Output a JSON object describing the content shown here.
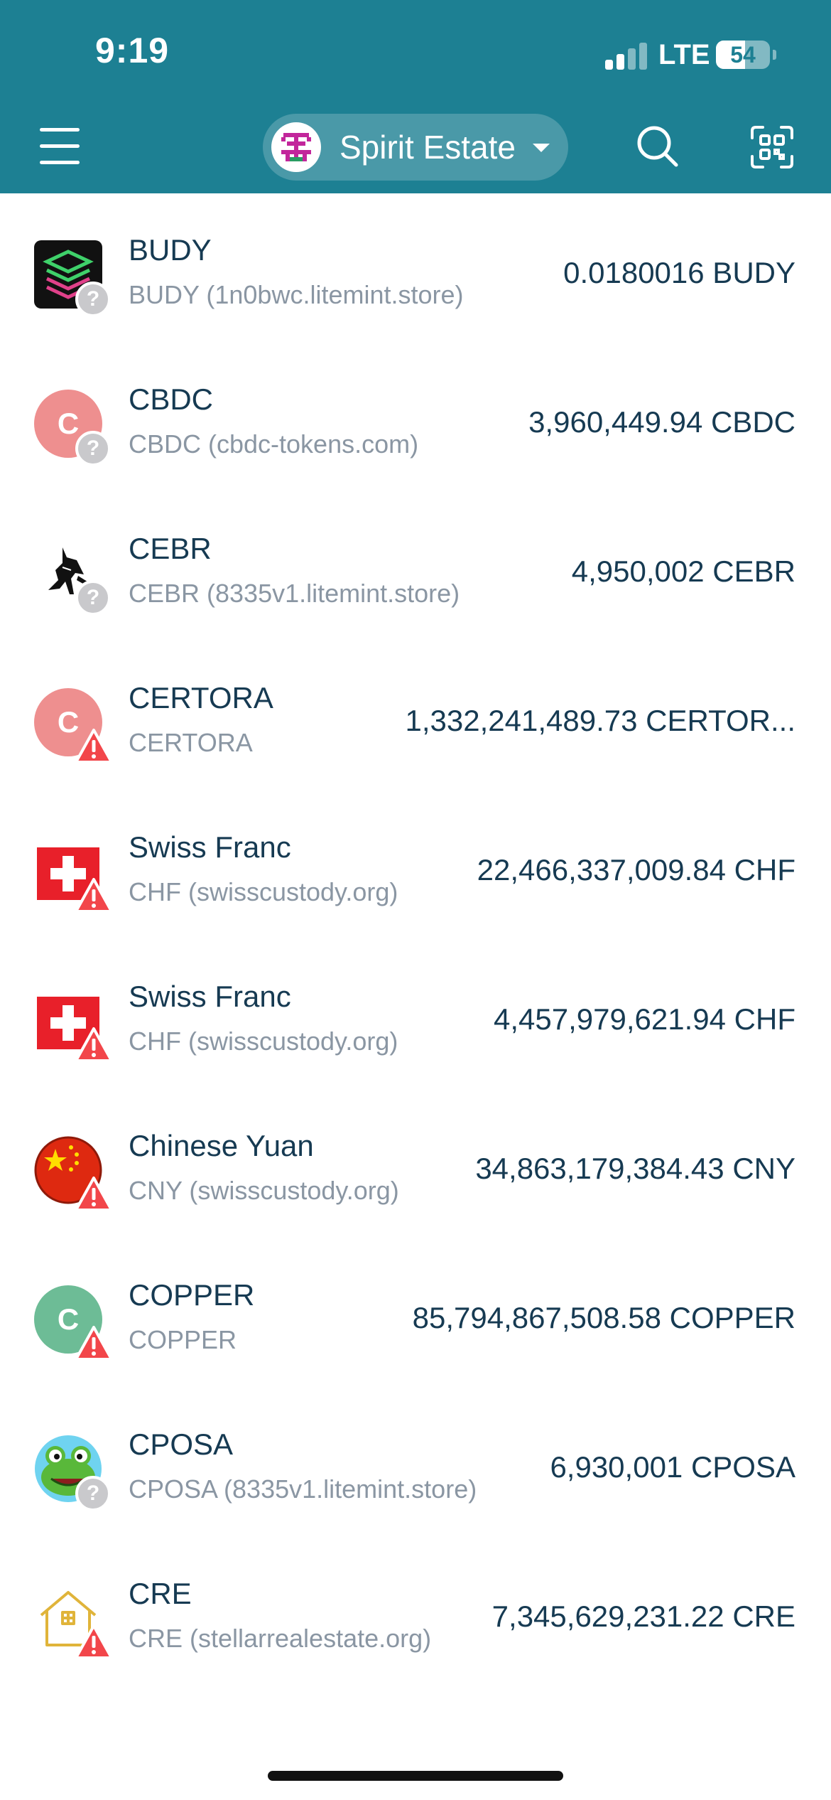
{
  "status_bar": {
    "time": "9:19",
    "network": "LTE",
    "battery": "54",
    "battery_level_percent": 54
  },
  "header": {
    "account_name": "Spirit Estate",
    "menu_icon": "hamburger-menu-icon",
    "search_icon": "search-icon",
    "scan_icon": "qr-scan-icon",
    "background_color": "#1d8093"
  },
  "assets": [
    {
      "name": "BUDY",
      "subtitle": "BUDY (1n0bwc.litemint.store)",
      "amount": "0.0180016 BUDY",
      "icon": "budy-logo-icon",
      "badge": "question"
    },
    {
      "name": "CBDC",
      "subtitle": "CBDC (cbdc-tokens.com)",
      "amount": "3,960,449.94 CBDC",
      "icon": "letter-avatar",
      "letter": "C",
      "avatar_color": "#ee8f8f",
      "badge": "question"
    },
    {
      "name": "CEBR",
      "subtitle": "CEBR (8335v1.litemint.store)",
      "amount": "4,950,002 CEBR",
      "icon": "horse-logo-icon",
      "badge": "question"
    },
    {
      "name": "CERTORA",
      "subtitle": "CERTORA",
      "amount": "1,332,241,489.73 CERTOR...",
      "icon": "letter-avatar",
      "letter": "C",
      "avatar_color": "#ee8f8f",
      "badge": "warning"
    },
    {
      "name": "Swiss Franc",
      "subtitle": "CHF (swisscustody.org)",
      "amount": "22,466,337,009.84 CHF",
      "icon": "swiss-flag-icon",
      "badge": "warning"
    },
    {
      "name": "Swiss Franc",
      "subtitle": "CHF (swisscustody.org)",
      "amount": "4,457,979,621.94 CHF",
      "icon": "swiss-flag-icon",
      "badge": "warning"
    },
    {
      "name": "Chinese Yuan",
      "subtitle": "CNY (swisscustody.org)",
      "amount": "34,863,179,384.43 CNY",
      "icon": "china-flag-icon",
      "badge": "warning"
    },
    {
      "name": "COPPER",
      "subtitle": "COPPER",
      "amount": "85,794,867,508.58 COPPER",
      "icon": "letter-avatar",
      "letter": "C",
      "avatar_color": "#6dbc96",
      "badge": "warning"
    },
    {
      "name": "CPOSA",
      "subtitle": "CPOSA (8335v1.litemint.store)",
      "amount": "6,930,001 CPOSA",
      "icon": "frog-logo-icon",
      "badge": "question"
    },
    {
      "name": "CRE",
      "subtitle": "CRE (stellarrealestate.org)",
      "amount": "7,345,629,231.22 CRE",
      "icon": "house-logo-icon",
      "badge": "warning"
    }
  ]
}
